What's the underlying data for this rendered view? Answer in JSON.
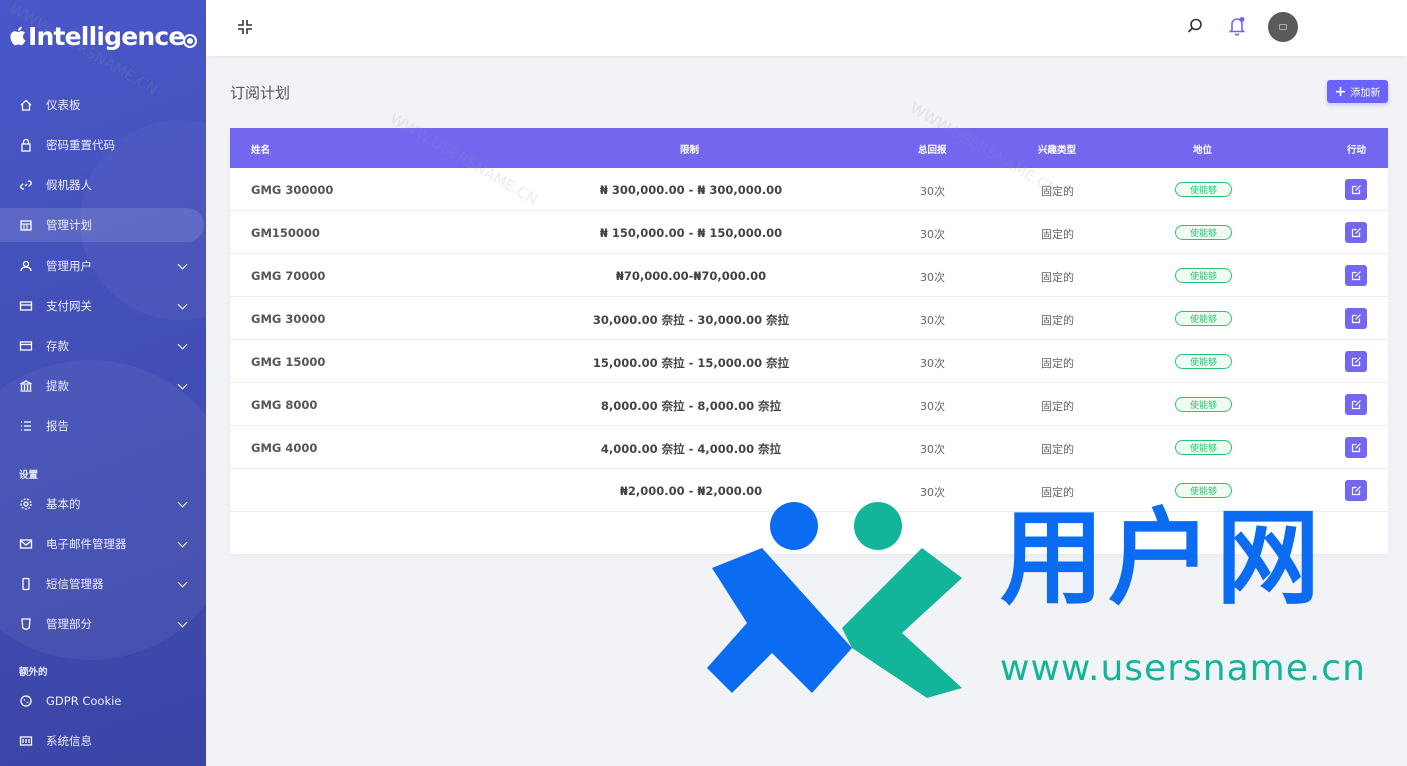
{
  "app": {
    "brand": "Intelligence"
  },
  "sidebar": {
    "items": [
      {
        "label": "仪表板",
        "icon": "home-icon"
      },
      {
        "label": "密码重置代码",
        "icon": "lock-icon"
      },
      {
        "label": "假机器人",
        "icon": "link-icon"
      },
      {
        "label": "管理计划",
        "icon": "calendar-icon",
        "active": true
      },
      {
        "label": "管理用户",
        "icon": "users-icon"
      },
      {
        "label": "支付网关",
        "icon": "card-icon"
      },
      {
        "label": "存款",
        "icon": "wallet-icon"
      },
      {
        "label": "提款",
        "icon": "bank-icon"
      },
      {
        "label": "报告",
        "icon": "list-icon"
      }
    ],
    "section_settings": "设置",
    "settings_items": [
      {
        "label": "基本的",
        "icon": "gear-icon"
      },
      {
        "label": "电子邮件管理器",
        "icon": "mail-icon"
      },
      {
        "label": "短信管理器",
        "icon": "phone-icon"
      },
      {
        "label": "管理部分",
        "icon": "html-icon"
      }
    ],
    "section_extra": "额外的",
    "extra_items": [
      {
        "label": "GDPR Cookie",
        "icon": "cookie-icon"
      },
      {
        "label": "系统信息",
        "icon": "server-icon"
      }
    ]
  },
  "page": {
    "title": "订阅计划",
    "add_label": "添加新"
  },
  "table": {
    "headers": {
      "name": "姓名",
      "limit": "限制",
      "return": "总回报",
      "interest_type": "兴趣类型",
      "status": "地位",
      "action": "行动"
    },
    "rows": [
      {
        "name": "GMG 300000",
        "limit": "₦ 300,000.00 - ₦ 300,000.00",
        "return": "30次",
        "type": "固定的",
        "status": "使能够"
      },
      {
        "name": "GM150000",
        "limit": "₦ 150,000.00 - ₦ 150,000.00",
        "return": "30次",
        "type": "固定的",
        "status": "使能够"
      },
      {
        "name": "GMG 70000",
        "limit": "₦70,000.00-₦70,000.00",
        "return": "30次",
        "type": "固定的",
        "status": "使能够"
      },
      {
        "name": "GMG 30000",
        "limit": "30,000.00 奈拉 - 30,000.00 奈拉",
        "return": "30次",
        "type": "固定的",
        "status": "使能够"
      },
      {
        "name": "GMG 15000",
        "limit": "15,000.00 奈拉 - 15,000.00 奈拉",
        "return": "30次",
        "type": "固定的",
        "status": "使能够"
      },
      {
        "name": "GMG 8000",
        "limit": "8,000.00 奈拉 - 8,000.00 奈拉",
        "return": "30次",
        "type": "固定的",
        "status": "使能够"
      },
      {
        "name": "GMG 4000",
        "limit": "4,000.00 奈拉 - 4,000.00 奈拉",
        "return": "30次",
        "type": "固定的",
        "status": "使能够"
      },
      {
        "name": "",
        "limit": "₦2,000.00 - ₦2,000.00",
        "return": "30次",
        "type": "固定的",
        "status": "使能够"
      }
    ]
  },
  "watermark": {
    "cn": "用户网",
    "url": "www.usersname.cn",
    "faint": "WWW.USERSNAME.CN"
  },
  "colors": {
    "primary": "#7367f0",
    "success": "#28c76f",
    "sidebar": "#4350b9"
  }
}
